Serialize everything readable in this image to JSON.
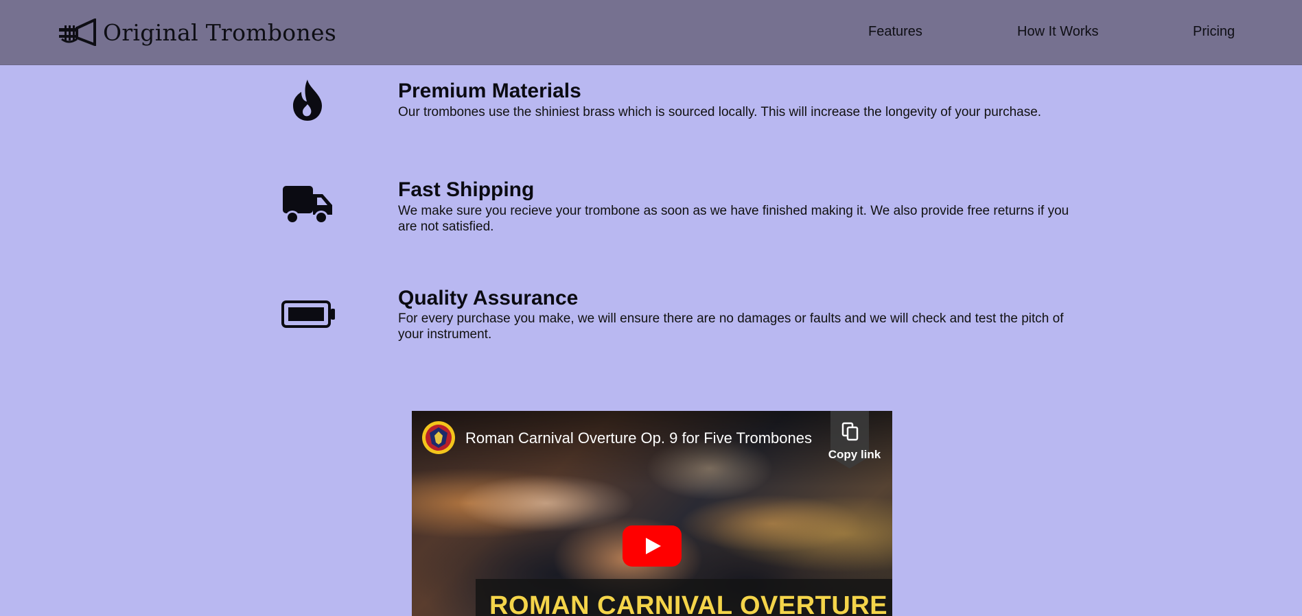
{
  "header": {
    "brand": "Original Trombones",
    "logo_icon": "trumpet-icon",
    "nav": [
      "Features",
      "How It Works",
      "Pricing"
    ]
  },
  "features": [
    {
      "icon": "fire-icon",
      "title": "Premium Materials",
      "description": "Our trombones use the shiniest brass which is sourced locally. This will increase the longevity of your purchase."
    },
    {
      "icon": "truck-icon",
      "title": "Fast Shipping",
      "description": "We make sure you recieve your trombone as soon as we have finished making it. We also provide free returns if you are not satisfied."
    },
    {
      "icon": "battery-full-icon",
      "title": "Quality Assurance",
      "description": "For every purchase you make, we will ensure there are no damages or faults and we will check and test the pitch of your instrument."
    }
  ],
  "video": {
    "title": "Roman Carnival Overture Op. 9 for Five Trombones",
    "copy_link_label": "Copy link",
    "banner_text": "ROMAN CARNIVAL OVERTURE"
  },
  "colors": {
    "page_bg": "#b9b8f1",
    "header_bg": "#767190",
    "play_button": "#ff0000",
    "banner_text": "#f4d44a"
  }
}
